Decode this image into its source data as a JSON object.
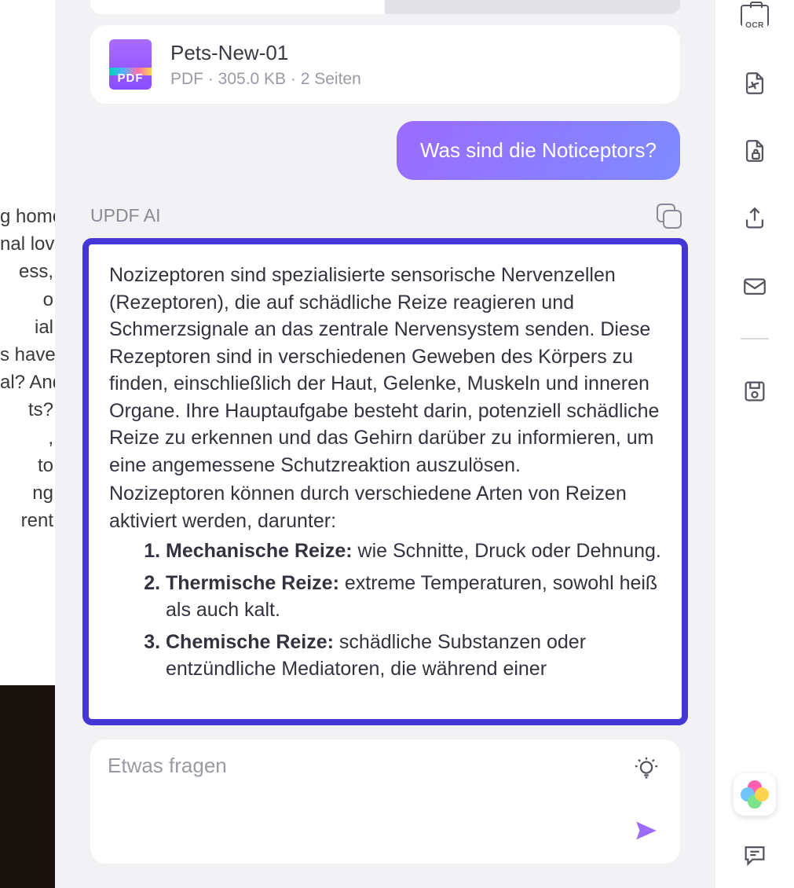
{
  "left_fragments": [
    "g home",
    "nal love",
    " ",
    "ess,",
    "o",
    "ial",
    " ",
    "s have",
    "al? And",
    "ts?",
    " ",
    ",",
    "to",
    "ng",
    " ",
    " ",
    "rent"
  ],
  "file": {
    "badge_text": "PDF",
    "name": "Pets-New-01",
    "meta": "PDF · 305.0 KB · 2 Seiten"
  },
  "user_message": "Was sind die Noticeptors?",
  "ai_label": "UPDF AI",
  "answer": {
    "p1": "Nozizeptoren sind spezialisierte sensorische Nervenzellen (Rezeptoren), die auf schädliche Reize reagieren und Schmerzsignale an das zentrale Nervensystem senden. Diese Rezeptoren sind in verschiedenen Geweben des Körpers zu finden, einschließlich der Haut, Gelenke, Muskeln und inneren Organe. Ihre Hauptaufgabe besteht darin, potenziell schädliche Reize zu erkennen und das Gehirn darüber zu informieren, um eine angemessene Schutzreaktion auszulösen.",
    "p2": "Nozizeptoren können durch verschiedene Arten von Reizen aktiviert werden, darunter:",
    "list": [
      {
        "bold": "Mechanische Reize:",
        "rest": " wie Schnitte, Druck oder Dehnung."
      },
      {
        "bold": "Thermische Reize:",
        "rest": " extreme Temperaturen, sowohl heiß als auch kalt."
      },
      {
        "bold": "Chemische Reize:",
        "rest": " schädliche Substanzen oder entzündliche Mediatoren, die während einer"
      }
    ]
  },
  "input": {
    "placeholder": "Etwas fragen"
  },
  "sidebar": {
    "ocr_label": "OCR"
  }
}
